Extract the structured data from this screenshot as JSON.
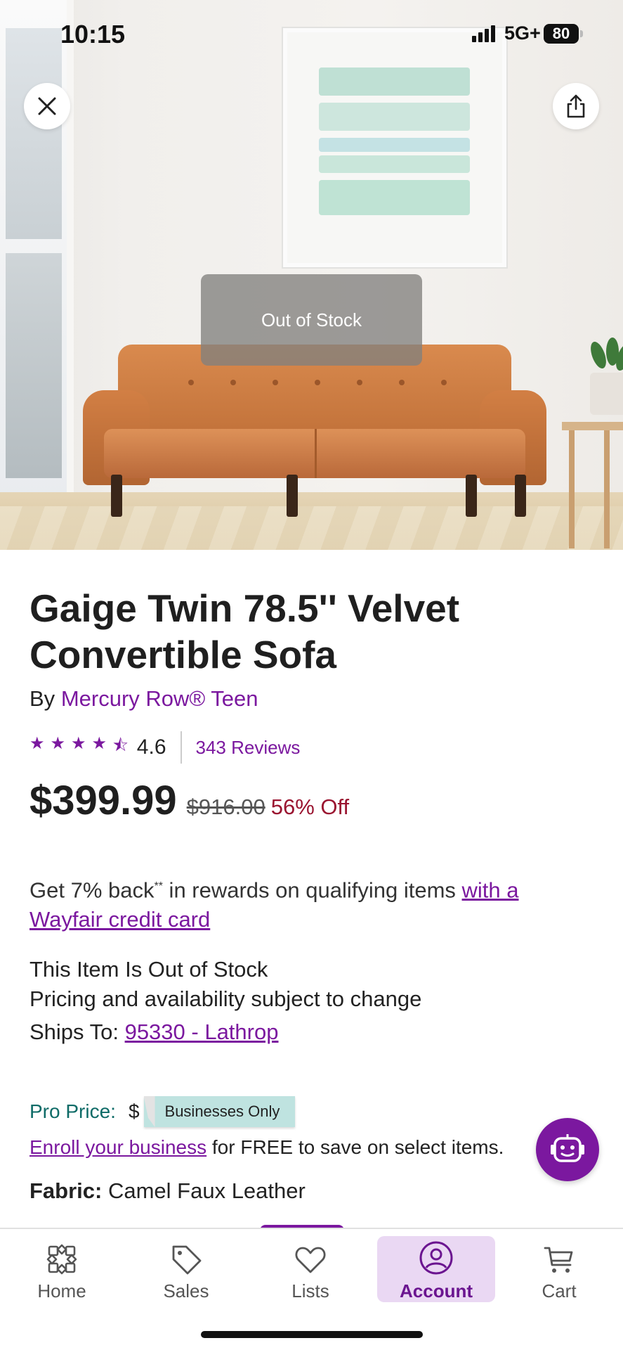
{
  "status_bar": {
    "time": "10:15",
    "network": "5G+",
    "battery": "80"
  },
  "hero": {
    "overlay_text": "Out of Stock"
  },
  "product": {
    "title": "Gaige Twin 78.5'' Velvet Convertible Sofa",
    "by_prefix": "By",
    "brand": "Mercury Row® Teen",
    "rating": "4.6",
    "rating_fraction": 0.92,
    "reviews": "343 Reviews",
    "price": "$399.99",
    "was_price": "$916.00",
    "discount": "56% Off"
  },
  "rewards": {
    "text": "Get 7% back",
    "sup": "**",
    "text2": " in rewards on qualifying items ",
    "link": "with a Wayfair credit card"
  },
  "availability": {
    "line1": "This Item Is Out of Stock",
    "line2": "Pricing and availability subject to change",
    "ships_label": "Ships To: ",
    "ships_link": "95330 - Lathrop"
  },
  "pro": {
    "label": "Pro Price:",
    "dollar": "$",
    "tag": "Businesses Only",
    "enroll_link": "Enroll your business",
    "enroll_text": " for FREE to save on select items."
  },
  "fabric": {
    "label": "Fabric:",
    "value": " Camel Faux Leather"
  },
  "nav": {
    "home": "Home",
    "sales": "Sales",
    "lists": "Lists",
    "account": "Account",
    "cart": "Cart"
  },
  "colors": {
    "brand": "#7b189f",
    "sale": "#9a1430",
    "pro": "#0e6b67",
    "tag": "#bfe3e0"
  }
}
